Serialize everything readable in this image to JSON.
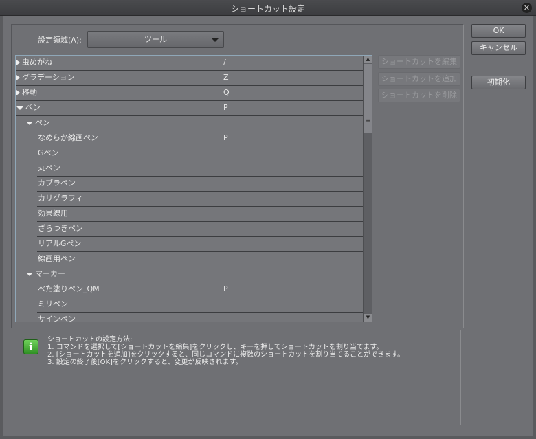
{
  "window": {
    "title": "ショートカット設定"
  },
  "area": {
    "label": "設定領域(A):",
    "value": "ツール"
  },
  "list": {
    "rows": [
      {
        "label": "虫めがね",
        "key": "/",
        "level": 0,
        "expander": "collapsed"
      },
      {
        "label": "グラデーション",
        "key": "Z",
        "level": 0,
        "expander": "collapsed"
      },
      {
        "label": "移動",
        "key": "Q",
        "level": 0,
        "expander": "collapsed"
      },
      {
        "label": "ペン",
        "key": "P",
        "level": 0,
        "expander": "expanded"
      },
      {
        "label": "ペン",
        "key": "",
        "level": 1,
        "expander": "expanded"
      },
      {
        "label": "なめらか線画ペン",
        "key": "P",
        "level": 2,
        "expander": "none"
      },
      {
        "label": "Gペン",
        "key": "",
        "level": 2,
        "expander": "none"
      },
      {
        "label": "丸ペン",
        "key": "",
        "level": 2,
        "expander": "none"
      },
      {
        "label": "カブラペン",
        "key": "",
        "level": 2,
        "expander": "none"
      },
      {
        "label": "カリグラフィ",
        "key": "",
        "level": 2,
        "expander": "none"
      },
      {
        "label": "効果線用",
        "key": "",
        "level": 2,
        "expander": "none"
      },
      {
        "label": "ざらつきペン",
        "key": "",
        "level": 2,
        "expander": "none"
      },
      {
        "label": "リアルGペン",
        "key": "",
        "level": 2,
        "expander": "none"
      },
      {
        "label": "線画用ペン",
        "key": "",
        "level": 2,
        "expander": "none"
      },
      {
        "label": "マーカー",
        "key": "",
        "level": 1,
        "expander": "expanded"
      },
      {
        "label": "べた塗りペン_QM",
        "key": "P",
        "level": 2,
        "expander": "none"
      },
      {
        "label": "ミリペン",
        "key": "",
        "level": 2,
        "expander": "none"
      },
      {
        "label": "サインペン",
        "key": "",
        "level": 2,
        "expander": "none"
      }
    ]
  },
  "shortcut_buttons": {
    "edit": "ショートカットを編集",
    "add": "ショートカットを追加",
    "delete": "ショートカットを削除"
  },
  "dialog_buttons": {
    "ok": "OK",
    "cancel": "キャンセル",
    "reset": "初期化"
  },
  "info": {
    "lines": [
      "ショートカットの設定方法:",
      "1. コマンドを選択して[ショートカットを編集]をクリックし、キーを押してショートカットを割り当てます。",
      "2. [ショートカットを追加]をクリックすると、同じコマンドに複数のショートカットを割り当てることができます。",
      "3. 設定の終了後[OK]をクリックすると、変更が反映されます。"
    ]
  }
}
